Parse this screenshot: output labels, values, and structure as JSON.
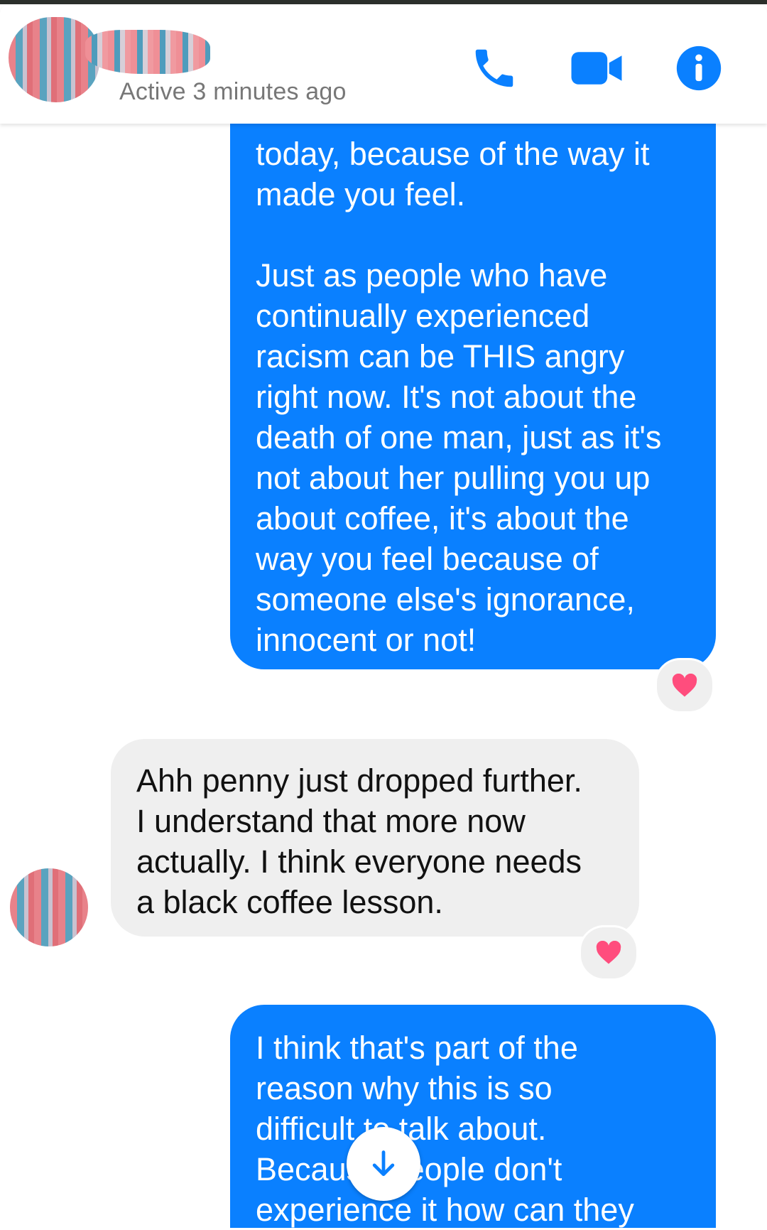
{
  "header": {
    "status": "Active 3 minutes ago",
    "icons": [
      "phone-icon",
      "video-icon",
      "info-icon"
    ],
    "accent_color": "#0a80ff"
  },
  "messages": [
    {
      "direction": "outgoing",
      "text": "today, because of the way it\nmade you feel.\n\nJust as people who have\ncontinually experienced\nracism can be THIS angry\nright now. It's not about the\ndeath of one man, just as it's\nnot about her pulling you up\nabout coffee, it's about the\nway you feel because of\nsomeone else's ignorance,\ninnocent or not!",
      "reaction": "heart"
    },
    {
      "direction": "incoming",
      "text": "Ahh penny just dropped further.\nI understand that more now\nactually. I think everyone needs\na black coffee lesson.",
      "reaction": "heart"
    },
    {
      "direction": "outgoing",
      "text": "I think that's part of the\nreason why this is so\ndifficult to talk about.\nBecause people don't\nexperience it how can they"
    }
  ],
  "colors": {
    "outgoing_bubble": "#0a80ff",
    "incoming_bubble": "#efefef",
    "heart": "#ff4d7d"
  }
}
